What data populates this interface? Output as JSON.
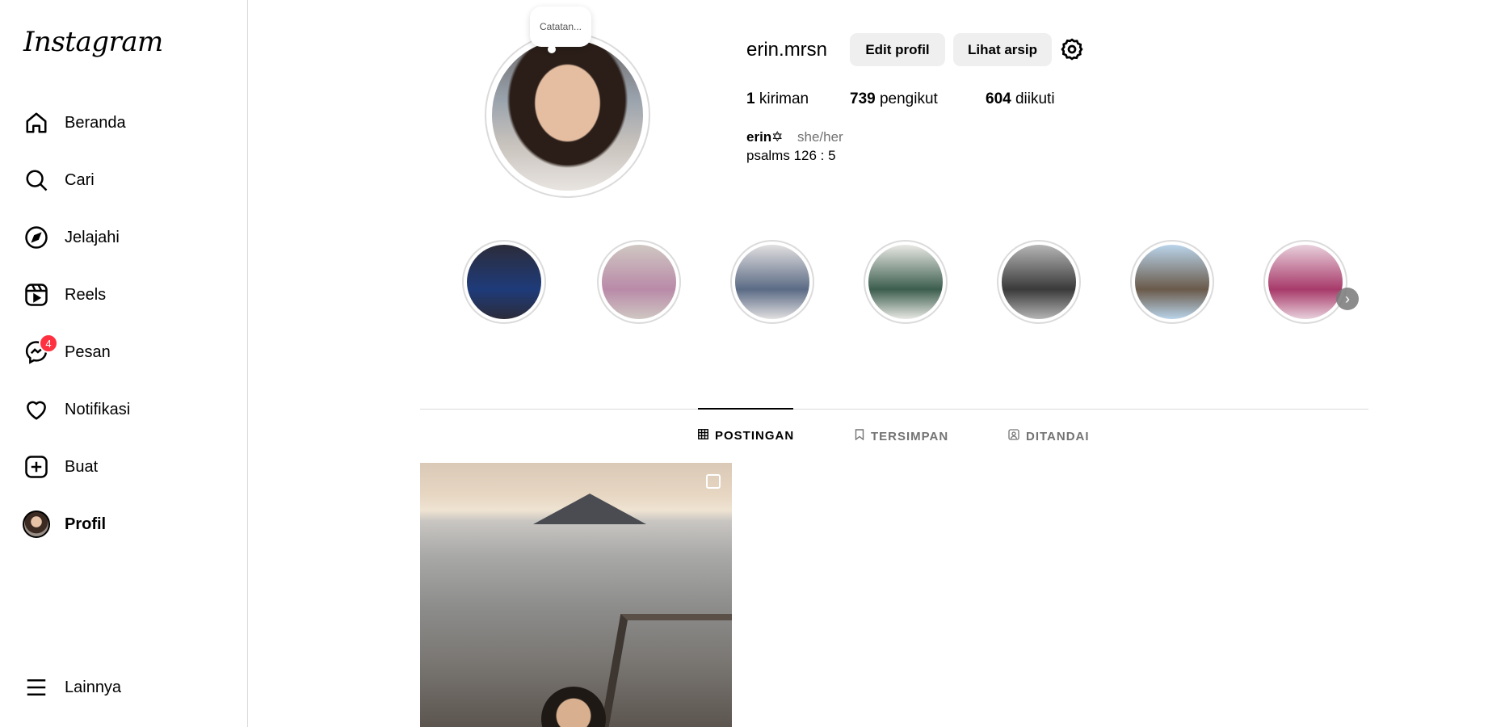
{
  "app": {
    "logo": "Instagram"
  },
  "sidebar": {
    "items": [
      {
        "label": "Beranda",
        "icon": "home-icon"
      },
      {
        "label": "Cari",
        "icon": "search-icon"
      },
      {
        "label": "Jelajahi",
        "icon": "compass-icon"
      },
      {
        "label": "Reels",
        "icon": "reels-icon"
      },
      {
        "label": "Pesan",
        "icon": "messenger-icon",
        "badge": "4"
      },
      {
        "label": "Notifikasi",
        "icon": "heart-icon"
      },
      {
        "label": "Buat",
        "icon": "plus-square-icon"
      },
      {
        "label": "Profil",
        "icon": "avatar"
      }
    ],
    "more": {
      "label": "Lainnya",
      "icon": "hamburger-icon"
    }
  },
  "profile": {
    "note": "Catatan...",
    "username": "erin.mrsn",
    "edit_button": "Edit profil",
    "archive_button": "Lihat arsip",
    "stats": {
      "posts_count": "1",
      "posts_label": "kiriman",
      "followers_count": "739",
      "followers_label": "pengikut",
      "following_count": "604",
      "following_label": "diikuti"
    },
    "bio_name": "erin✡",
    "bio_pronouns": "she/her",
    "bio_text": "psalms 126 : 5"
  },
  "highlights": [
    {
      "colors": [
        "#1e3b7a",
        "#2c2c3a"
      ]
    },
    {
      "colors": [
        "#b98aa8",
        "#cfc7c2"
      ]
    },
    {
      "colors": [
        "#5b6b85",
        "#e1dfe0"
      ]
    },
    {
      "colors": [
        "#3c5e4e",
        "#e8e8e4"
      ]
    },
    {
      "colors": [
        "#3a3a3a",
        "#b5b5b5"
      ]
    },
    {
      "colors": [
        "#6a5a4a",
        "#b9d4ea"
      ]
    },
    {
      "colors": [
        "#a83a6a",
        "#e8d0dc"
      ]
    }
  ],
  "tabs": [
    {
      "label": "POSTINGAN",
      "icon": "grid-icon",
      "active": true
    },
    {
      "label": "TERSIMPAN",
      "icon": "bookmark-icon",
      "active": false
    },
    {
      "label": "DITANDAI",
      "icon": "tagged-icon",
      "active": false
    }
  ],
  "accent_colors": {
    "badge": "#ff3040",
    "divider": "#dbdbdb",
    "button_bg": "#efefef"
  }
}
